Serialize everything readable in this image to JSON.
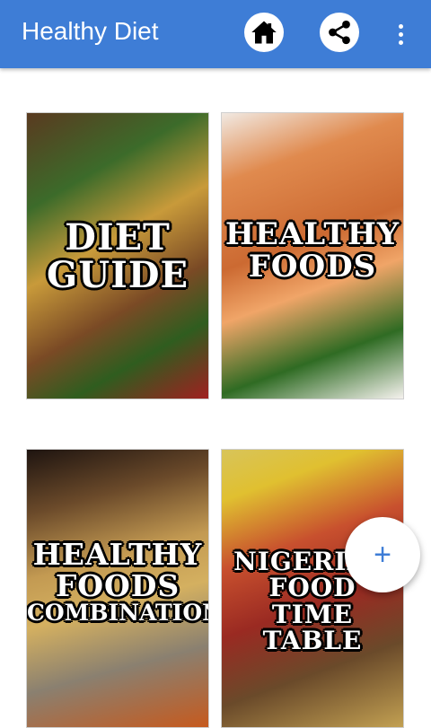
{
  "appbar": {
    "title": "Healthy Diet",
    "home_icon": "home-icon",
    "share_icon": "share-icon",
    "more_icon": "more-vertical-icon",
    "color": "#3e7dd6"
  },
  "tiles": [
    {
      "caption_line1": "DIET",
      "caption_line2": "GUIDE"
    },
    {
      "caption_line1": "HEALTHY",
      "caption_line2": "FOODS"
    },
    {
      "caption_line1": "HEALTHY",
      "caption_line2": "FOODS",
      "caption_line3": "COMBINATION"
    },
    {
      "caption_line1": "NIGERIAN",
      "caption_line2": "FOOD",
      "caption_line3": "TIME TABLE"
    }
  ],
  "fab": {
    "label": "+",
    "icon": "add-icon"
  }
}
